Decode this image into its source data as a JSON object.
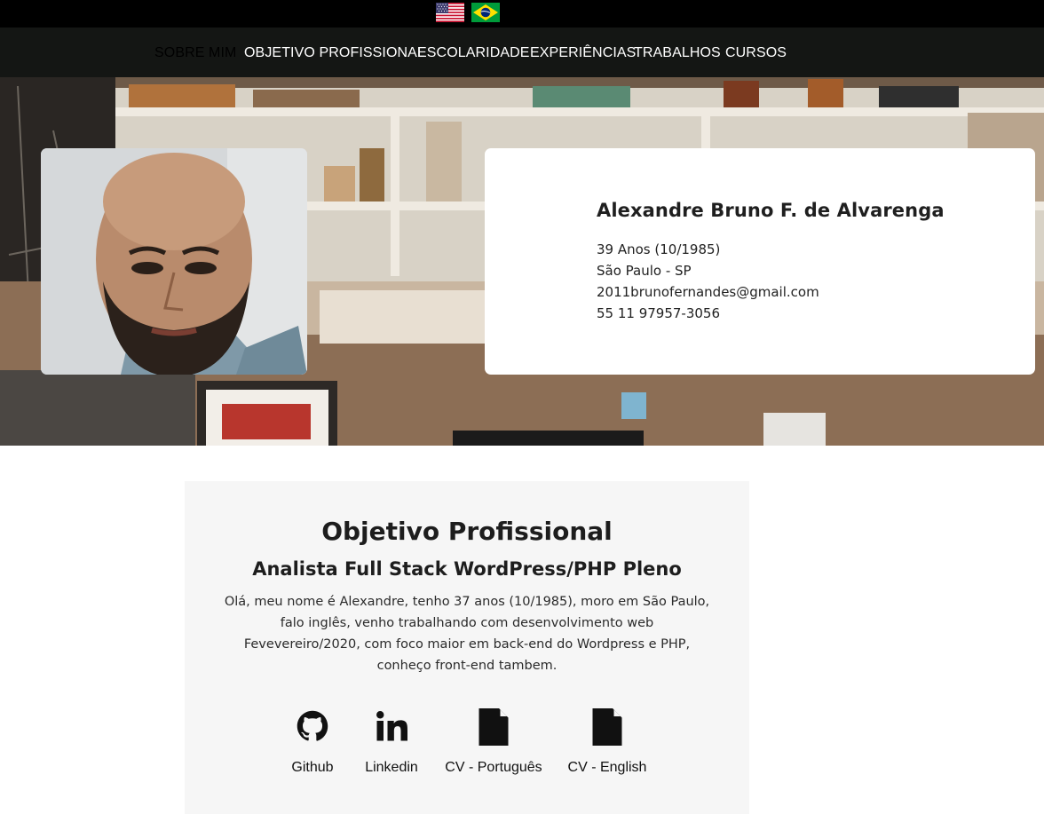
{
  "languages": [
    {
      "name": "English",
      "icon": "us-flag-icon"
    },
    {
      "name": "Português",
      "icon": "brazil-flag-icon"
    }
  ],
  "nav": {
    "items": [
      {
        "label": "SOBRE MIM",
        "active": true
      },
      {
        "label": "OBJETIVO PROFISSIONAL",
        "active": false
      },
      {
        "label": "ESCOLARIDADE",
        "active": false
      },
      {
        "label": "EXPERIÊNCIAS",
        "active": false
      },
      {
        "label": "TRABALHOS",
        "active": false
      },
      {
        "label": "CURSOS",
        "active": false
      }
    ]
  },
  "profile": {
    "name": "Alexandre Bruno F. de Alvarenga",
    "age": "39 Anos (10/1985)",
    "location": "São Paulo - SP",
    "email": "2011brunofernandes@gmail.com",
    "phone": "55 11 97957-3056"
  },
  "objective": {
    "title": "Objetivo Profissional",
    "subtitle": "Analista Full Stack WordPress/PHP Pleno",
    "text": "Olá, meu nome é Alexandre, tenho 37 anos (10/1985), moro em São Paulo, falo inglês, venho trabalhando com desenvolvimento web Fevevereiro/2020, com foco maior em back-end do Wordpress e PHP, conheço front-end tambem."
  },
  "links": [
    {
      "label": "Github",
      "icon": "github-icon"
    },
    {
      "label": "Linkedin",
      "icon": "linkedin-icon"
    },
    {
      "label": "CV - Português",
      "icon": "document-icon"
    },
    {
      "label": "CV - English",
      "icon": "document-icon"
    }
  ],
  "colors": {
    "topbar": "#000000",
    "navbar": "#141614",
    "nav_text": "#ffffff",
    "section_bg": "#f6f6f6"
  }
}
